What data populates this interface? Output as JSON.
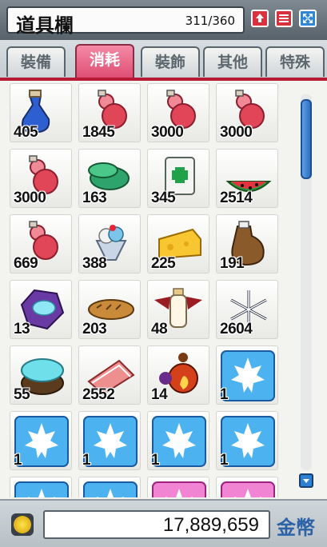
{
  "window": {
    "title": "道具欄",
    "capacity": "311/360",
    "buttons": [
      "plus-button",
      "list-button",
      "expand-button"
    ]
  },
  "tabs": [
    {
      "label": "裝備",
      "active": false
    },
    {
      "label": "消耗",
      "active": true
    },
    {
      "label": "裝飾",
      "active": false
    },
    {
      "label": "其他",
      "active": false
    },
    {
      "label": "特殊",
      "active": false
    }
  ],
  "items": [
    {
      "icon": "blue-potion-icon",
      "qty": "405"
    },
    {
      "icon": "red-gourd-potion-icon",
      "qty": "1845"
    },
    {
      "icon": "red-gourd-potion-icon",
      "qty": "3000"
    },
    {
      "icon": "red-gourd-potion-icon",
      "qty": "3000"
    },
    {
      "icon": "red-gourd-potion-icon",
      "qty": "3000"
    },
    {
      "icon": "green-pill-icon",
      "qty": "163"
    },
    {
      "icon": "medicine-bag-icon",
      "qty": "345"
    },
    {
      "icon": "watermelon-icon",
      "qty": "2514"
    },
    {
      "icon": "red-gourd-potion-icon",
      "qty": "669"
    },
    {
      "icon": "sundae-icon",
      "qty": "388"
    },
    {
      "icon": "cheese-icon",
      "qty": "225"
    },
    {
      "icon": "brown-jug-icon",
      "qty": "191"
    },
    {
      "icon": "purple-crystal-icon",
      "qty": "13"
    },
    {
      "icon": "bread-icon",
      "qty": "203"
    },
    {
      "icon": "milk-bottle-icon",
      "qty": "48"
    },
    {
      "icon": "snowflake-icon",
      "qty": "2604"
    },
    {
      "icon": "cyan-stump-icon",
      "qty": "55"
    },
    {
      "icon": "salmon-cake-icon",
      "qty": "2552"
    },
    {
      "icon": "fire-orb-icon",
      "qty": "14"
    },
    {
      "icon": "maple-leaf-icon",
      "qty": "1"
    },
    {
      "icon": "maple-leaf-icon",
      "qty": "1"
    },
    {
      "icon": "maple-leaf-icon",
      "qty": "1"
    },
    {
      "icon": "maple-leaf-icon",
      "qty": "1"
    },
    {
      "icon": "maple-leaf-icon",
      "qty": "1"
    },
    {
      "icon": "maple-leaf-icon",
      "qty": ""
    },
    {
      "icon": "maple-leaf-icon",
      "qty": ""
    },
    {
      "icon": "pink-leaf-icon",
      "qty": ""
    },
    {
      "icon": "pink-leaf-icon",
      "qty": ""
    }
  ],
  "footer": {
    "money": "17,889,659",
    "label": "金幣"
  }
}
